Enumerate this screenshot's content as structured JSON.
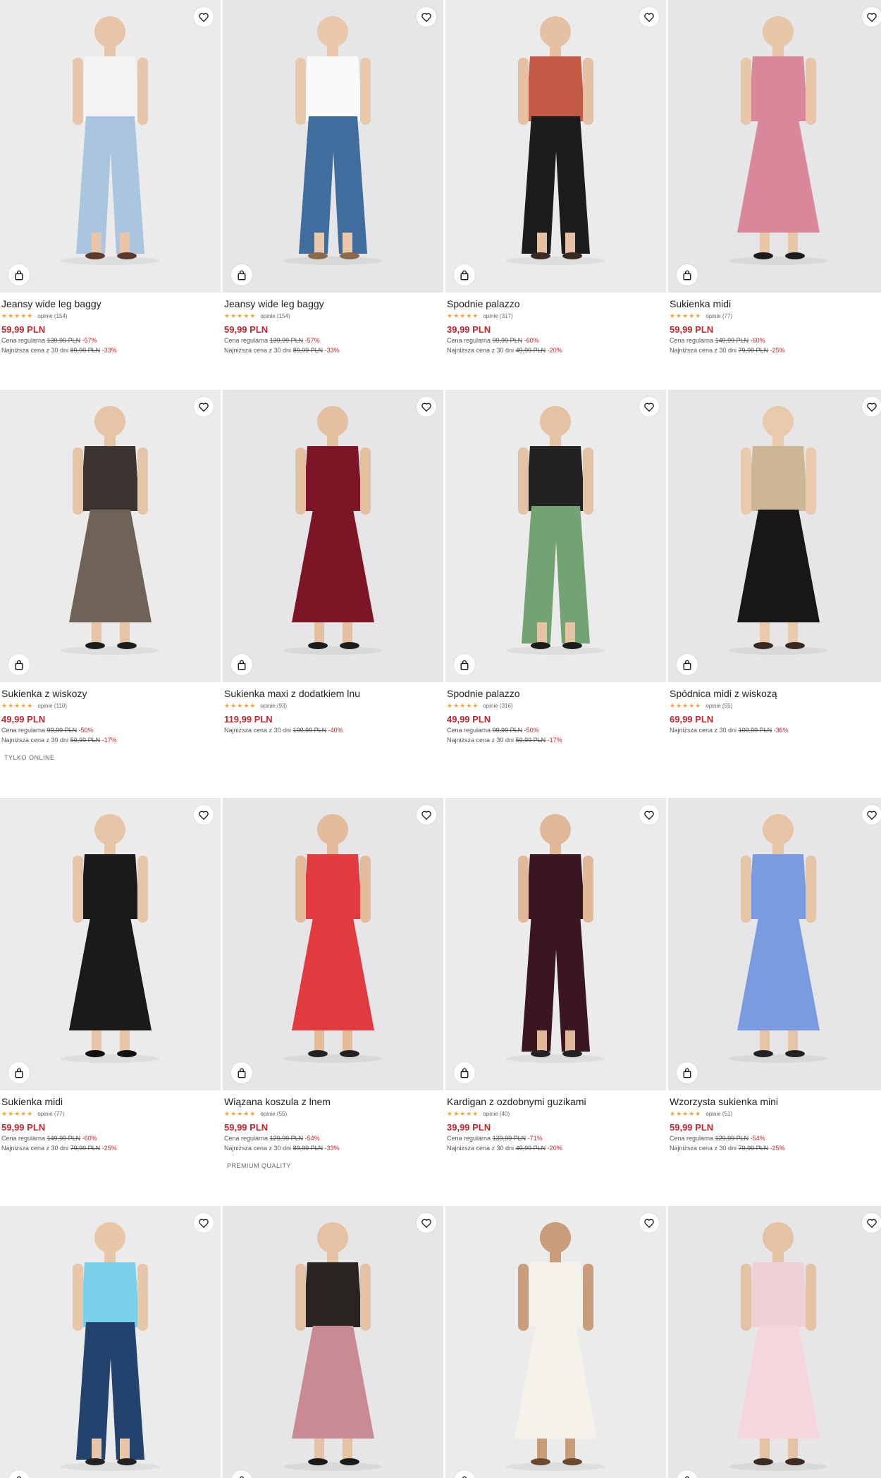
{
  "colors": {
    "price": "#c4262e",
    "star": "#f0a43a",
    "background": "#ffffff"
  },
  "icons": {
    "favorite": "heart-icon",
    "cart": "shopping-bag-icon"
  },
  "products": [
    {
      "name": "Jeansy wide leg baggy",
      "rating": 5,
      "reviews": "opinie (154)",
      "price": "59,99 PLN",
      "regular_label": "Cena regularna",
      "regular_price": "139,99 PLN",
      "regular_discount": "-57%",
      "lowest_label": "Najniższa cena z 30 dni",
      "lowest_price": "89,99 PLN",
      "lowest_discount": "-33%",
      "badge": ""
    },
    {
      "name": "Jeansy wide leg baggy",
      "rating": 5,
      "reviews": "opinie (154)",
      "price": "59,99 PLN",
      "regular_label": "Cena regularna",
      "regular_price": "139,99 PLN",
      "regular_discount": "-57%",
      "lowest_label": "Najniższa cena z 30 dni",
      "lowest_price": "89,99 PLN",
      "lowest_discount": "-33%",
      "badge": ""
    },
    {
      "name": "Spodnie palazzo",
      "rating": 4.5,
      "reviews": "opinie (317)",
      "price": "39,99 PLN",
      "regular_label": "Cena regularna",
      "regular_price": "99,99 PLN",
      "regular_discount": "-60%",
      "lowest_label": "Najniższa cena z 30 dni",
      "lowest_price": "49,99 PLN",
      "lowest_discount": "-20%",
      "badge": ""
    },
    {
      "name": "Sukienka midi",
      "rating": 4.5,
      "reviews": "opinie (77)",
      "price": "59,99 PLN",
      "regular_label": "Cena regularna",
      "regular_price": "149,99 PLN",
      "regular_discount": "-60%",
      "lowest_label": "Najniższa cena z 30 dni",
      "lowest_price": "79,99 PLN",
      "lowest_discount": "-25%",
      "badge": ""
    },
    {
      "name": "Sukienka z wiskozy",
      "rating": 5,
      "reviews": "opinie (110)",
      "price": "49,99 PLN",
      "regular_label": "Cena regularna",
      "regular_price": "99,99 PLN",
      "regular_discount": "-50%",
      "lowest_label": "Najniższa cena z 30 dni",
      "lowest_price": "59,99 PLN",
      "lowest_discount": "-17%",
      "badge": "TYLKO ONLINE"
    },
    {
      "name": "Sukienka maxi z dodatkiem lnu",
      "rating": 4.5,
      "reviews": "opinie (93)",
      "price": "119,99 PLN",
      "regular_label": "",
      "regular_price": "",
      "regular_discount": "",
      "lowest_label": "Najniższa cena z 30 dni",
      "lowest_price": "199,99 PLN",
      "lowest_discount": "-40%",
      "badge": ""
    },
    {
      "name": "Spodnie palazzo",
      "rating": 4.5,
      "reviews": "opinie (316)",
      "price": "49,99 PLN",
      "regular_label": "Cena regularna",
      "regular_price": "99,99 PLN",
      "regular_discount": "-50%",
      "lowest_label": "Najniższa cena z 30 dni",
      "lowest_price": "59,99 PLN",
      "lowest_discount": "-17%",
      "badge": ""
    },
    {
      "name": "Spódnica midi z wiskozą",
      "rating": 5,
      "reviews": "opinie (55)",
      "price": "69,99 PLN",
      "regular_label": "",
      "regular_price": "",
      "regular_discount": "",
      "lowest_label": "Najniższa cena z 30 dni",
      "lowest_price": "109,99 PLN",
      "lowest_discount": "-36%",
      "badge": ""
    },
    {
      "name": "Sukienka midi",
      "rating": 4.5,
      "reviews": "opinie (77)",
      "price": "59,99 PLN",
      "regular_label": "Cena regularna",
      "regular_price": "149,99 PLN",
      "regular_discount": "-60%",
      "lowest_label": "Najniższa cena z 30 dni",
      "lowest_price": "79,99 PLN",
      "lowest_discount": "-25%",
      "badge": ""
    },
    {
      "name": "Wiązana koszula z lnem",
      "rating": 4.5,
      "reviews": "opinie (55)",
      "price": "59,99 PLN",
      "regular_label": "Cena regularna",
      "regular_price": "129,99 PLN",
      "regular_discount": "-54%",
      "lowest_label": "Najniższa cena z 30 dni",
      "lowest_price": "89,99 PLN",
      "lowest_discount": "-33%",
      "badge": "PREMIUM QUALITY"
    },
    {
      "name": "Kardigan z ozdobnymi guzikami",
      "rating": 4.5,
      "reviews": "opinie (40)",
      "price": "39,99 PLN",
      "regular_label": "Cena regularna",
      "regular_price": "139,99 PLN",
      "regular_discount": "-71%",
      "lowest_label": "Najniższa cena z 30 dni",
      "lowest_price": "49,99 PLN",
      "lowest_discount": "-20%",
      "badge": ""
    },
    {
      "name": "Wzorzysta sukienka mini",
      "rating": 5,
      "reviews": "opinie (51)",
      "price": "59,99 PLN",
      "regular_label": "Cena regularna",
      "regular_price": "129,99 PLN",
      "regular_discount": "-54%",
      "lowest_label": "Najniższa cena z 30 dni",
      "lowest_price": "79,99 PLN",
      "lowest_discount": "-25%",
      "badge": ""
    },
    {
      "name": "",
      "rating": 0,
      "reviews": "",
      "price": "",
      "regular_label": "",
      "regular_price": "",
      "regular_discount": "",
      "lowest_label": "",
      "lowest_price": "",
      "lowest_discount": "",
      "badge": ""
    },
    {
      "name": "",
      "rating": 0,
      "reviews": "",
      "price": "",
      "regular_label": "",
      "regular_price": "",
      "regular_discount": "",
      "lowest_label": "",
      "lowest_price": "",
      "lowest_discount": "",
      "badge": ""
    },
    {
      "name": "",
      "rating": 0,
      "reviews": "",
      "price": "",
      "regular_label": "",
      "regular_price": "",
      "regular_discount": "",
      "lowest_label": "",
      "lowest_price": "",
      "lowest_discount": "",
      "badge": ""
    },
    {
      "name": "",
      "rating": 0,
      "reviews": "",
      "price": "",
      "regular_label": "",
      "regular_price": "",
      "regular_discount": "",
      "lowest_label": "",
      "lowest_price": "",
      "lowest_discount": "",
      "badge": ""
    }
  ]
}
